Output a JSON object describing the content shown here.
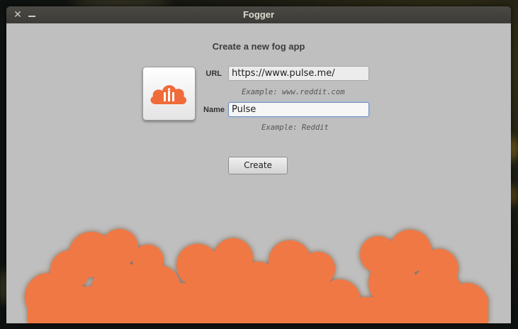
{
  "window": {
    "title": "Fogger",
    "controls": [
      "close-icon",
      "minimize-icon"
    ]
  },
  "form": {
    "heading": "Create a new fog app",
    "url_label": "URL",
    "url_value": "https://www.pulse.me/",
    "url_hint": "Example: www.reddit.com",
    "name_label": "Name",
    "name_value": "Pulse",
    "name_hint": "Example: Reddit",
    "create_label": "Create"
  },
  "app_icon": "orange-cloud-icon",
  "colors": {
    "accent": "#f06b3a",
    "window_bg": "#bfbfbf",
    "titlebar": "#3c3b37"
  }
}
